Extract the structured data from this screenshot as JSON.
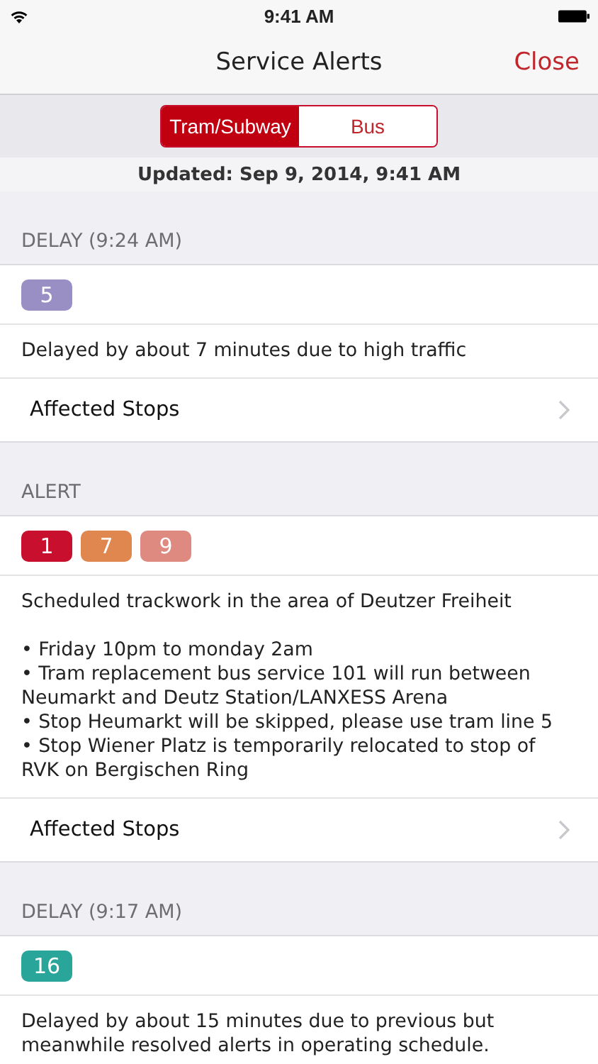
{
  "status_bar": {
    "time": "9:41 AM"
  },
  "nav": {
    "title": "Service Alerts",
    "close": "Close"
  },
  "tabs": [
    {
      "label": "Tram/Subway",
      "selected": true
    },
    {
      "label": "Bus",
      "selected": false
    }
  ],
  "updated": "Updated: Sep 9, 2014, 9:41 AM",
  "sections": [
    {
      "header": "DELAY (9:24 AM)",
      "lines": [
        {
          "label": "5",
          "color": "#9a8fc4"
        }
      ],
      "description": "Delayed by about 7 minutes due to high traffic",
      "link": "Affected Stops"
    },
    {
      "header": "ALERT",
      "lines": [
        {
          "label": "1",
          "color": "#c8102e"
        },
        {
          "label": "7",
          "color": "#e0874f"
        },
        {
          "label": "9",
          "color": "#df8a80"
        }
      ],
      "description": "Scheduled trackwork in the area of Deutzer Freiheit\n\n• Friday 10pm to monday 2am\n• Tram replacement bus service 101 will run between Neumarkt and Deutz Station/LANXESS Arena\n• Stop Heumarkt will be skipped, please use tram line 5\n• Stop Wiener Platz is temporarily relocated to stop of RVK on Bergischen Ring",
      "link": "Affected Stops"
    },
    {
      "header": "DELAY (9:17 AM)",
      "lines": [
        {
          "label": "16",
          "color": "#2aa59a"
        }
      ],
      "description": "Delayed by about 15 minutes due to previous but meanwhile resolved alerts in operating schedule."
    }
  ]
}
